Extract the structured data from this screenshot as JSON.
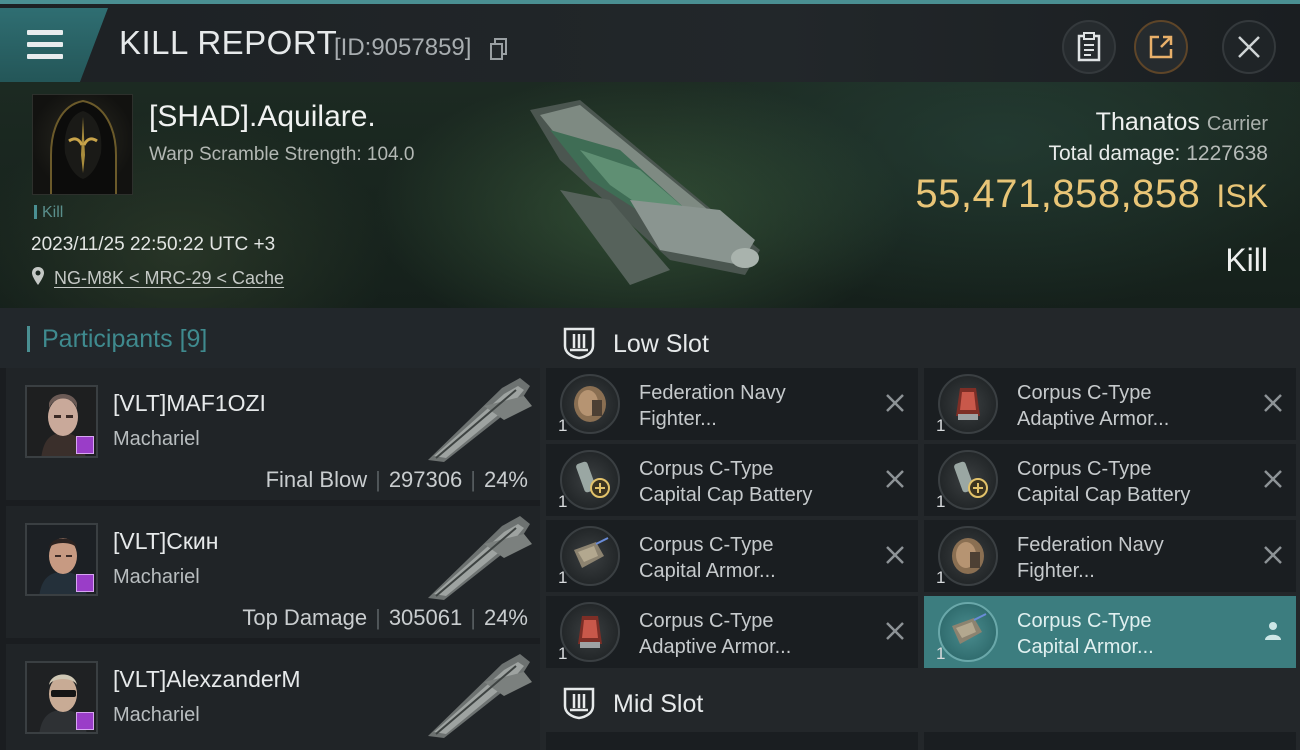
{
  "header": {
    "title": "KILL REPORT",
    "report_id": "[ID:9057859]",
    "buttons": [
      "clipboard-icon",
      "share-icon",
      "close-icon"
    ]
  },
  "victim": {
    "name": "[SHAD].Aquilare.",
    "scramble": "Warp Scramble Strength: 104.0",
    "tag": "Kill",
    "datetime": "2023/11/25 22:50:22 UTC +3",
    "location": "NG-M8K < MRC-29 < Cache",
    "ship": "Thanatos",
    "ship_class": "Carrier",
    "total_damage_label": "Total damage:",
    "total_damage": "1227638",
    "isk_value": "55,471,858,858",
    "isk_unit": "ISK",
    "result": "Kill"
  },
  "participants": {
    "title": "Participants",
    "count": "[9]",
    "list": [
      {
        "name": "[VLT]MAF1OZI",
        "ship": "Machariel",
        "role": "Final Blow",
        "damage": "297306",
        "pct": "24%"
      },
      {
        "name": "[VLT]Скин",
        "ship": "Machariel",
        "role": "Top Damage",
        "damage": "305061",
        "pct": "24%"
      },
      {
        "name": "[VLT]AlexzanderM",
        "ship": "Machariel",
        "role": "",
        "damage": "",
        "pct": ""
      }
    ]
  },
  "fitting": {
    "low_slot_label": "Low Slot",
    "mid_slot_label": "Mid Slot",
    "low_slot": [
      {
        "qty": "1",
        "line1": "Federation Navy",
        "line2": "Fighter...",
        "status": "destroyed"
      },
      {
        "qty": "1",
        "line1": "Corpus C-Type",
        "line2": "Adaptive Armor...",
        "status": "destroyed"
      },
      {
        "qty": "1",
        "line1": "Corpus C-Type",
        "line2": "Capital Cap Battery",
        "status": "destroyed"
      },
      {
        "qty": "1",
        "line1": "Corpus C-Type",
        "line2": "Capital Cap Battery",
        "status": "destroyed"
      },
      {
        "qty": "1",
        "line1": "Corpus C-Type",
        "line2": "Capital Armor...",
        "status": "destroyed"
      },
      {
        "qty": "1",
        "line1": "Federation Navy",
        "line2": "Fighter...",
        "status": "destroyed"
      },
      {
        "qty": "1",
        "line1": "Corpus C-Type",
        "line2": "Adaptive Armor...",
        "status": "destroyed"
      },
      {
        "qty": "1",
        "line1": "Corpus C-Type",
        "line2": "Capital Armor...",
        "status": "dropped"
      }
    ]
  },
  "colors": {
    "accent": "#4a8f92",
    "isk": "#e9c577",
    "active_row": "#3c7d7f",
    "corp_badge": "#9a3dc8"
  }
}
